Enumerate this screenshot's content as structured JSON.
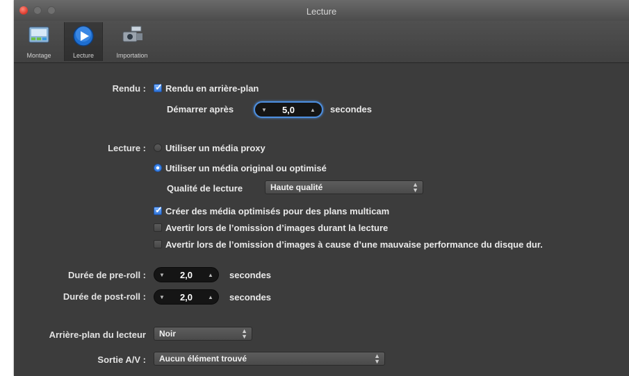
{
  "window": {
    "title": "Lecture"
  },
  "toolbar": {
    "items": [
      {
        "label": "Montage",
        "icon": "film-editing-icon"
      },
      {
        "label": "Lecture",
        "icon": "play-icon",
        "selected": true
      },
      {
        "label": "Importation",
        "icon": "import-camera-icon"
      }
    ]
  },
  "render": {
    "section_label": "Rendu :",
    "background_render": {
      "label": "Rendu en arrière-plan",
      "checked": true
    },
    "start_after": {
      "label": "Démarrer après",
      "value": "5,0",
      "unit": "secondes"
    }
  },
  "playback": {
    "section_label": "Lecture :",
    "options": [
      {
        "label": "Utiliser un média proxy",
        "selected": false
      },
      {
        "label": "Utiliser un média original ou optimisé",
        "selected": true
      }
    ],
    "quality": {
      "label": "Qualité de lecture",
      "value": "Haute qualité"
    },
    "checkboxes": [
      {
        "label": "Créer des média optimisés pour des plans multicam",
        "checked": true
      },
      {
        "label": "Avertir lors de l’omission d’images durant la lecture",
        "checked": false
      },
      {
        "label": "Avertir lors de l’omission d’images à cause d’une mauvaise performance du disque dur.",
        "checked": false
      }
    ]
  },
  "preroll": {
    "label": "Durée de pre-roll :",
    "value": "2,0",
    "unit": "secondes"
  },
  "postroll": {
    "label": "Durée de post-roll :",
    "value": "2,0",
    "unit": "secondes"
  },
  "player_background": {
    "label": "Arrière-plan du lecteur",
    "value": "Noir"
  },
  "av_output": {
    "label": "Sortie A/V :",
    "value": "Aucun élément trouvé"
  }
}
